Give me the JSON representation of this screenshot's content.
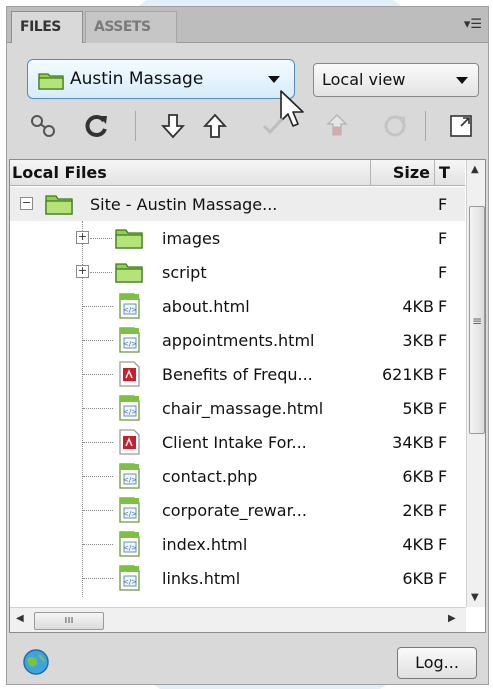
{
  "tabs": [
    {
      "label": "FILES",
      "active": true
    },
    {
      "label": "ASSETS",
      "active": false
    }
  ],
  "panel_menu_icon": "panel-options-icon",
  "site_select": {
    "value": "Austin Massage"
  },
  "view_select": {
    "value": "Local view"
  },
  "toolbar": {
    "icons": [
      "connect-icon",
      "refresh-icon",
      "get-files-icon",
      "put-files-icon",
      "check-out-icon",
      "check-in-icon",
      "synchronize-icon",
      "expand-panel-icon"
    ]
  },
  "columns": {
    "local_files": "Local Files",
    "size": "Size",
    "type": "T"
  },
  "root": {
    "name": "Site - Austin Massage...",
    "type": "F"
  },
  "files": [
    {
      "name": "images",
      "size": "",
      "type": "F",
      "kind": "folder"
    },
    {
      "name": "script",
      "size": "",
      "type": "F",
      "kind": "folder"
    },
    {
      "name": "about.html",
      "size": "4KB",
      "type": "F",
      "kind": "html"
    },
    {
      "name": "appointments.html",
      "size": "3KB",
      "type": "F",
      "kind": "html"
    },
    {
      "name": "Benefits of Frequ...",
      "size": "621KB",
      "type": "F",
      "kind": "pdf"
    },
    {
      "name": "chair_massage.html",
      "size": "5KB",
      "type": "F",
      "kind": "html"
    },
    {
      "name": "Client Intake For...",
      "size": "34KB",
      "type": "F",
      "kind": "pdf"
    },
    {
      "name": "contact.php",
      "size": "6KB",
      "type": "F",
      "kind": "html"
    },
    {
      "name": "corporate_rewar...",
      "size": "2KB",
      "type": "F",
      "kind": "html"
    },
    {
      "name": "index.html",
      "size": "4KB",
      "type": "F",
      "kind": "html"
    },
    {
      "name": "links.html",
      "size": "6KB",
      "type": "F",
      "kind": "html"
    }
  ],
  "footer": {
    "log_label": "Log..."
  },
  "colors": {
    "accent": "#4f8fbf",
    "folder_green": "#7cc242",
    "pdf_red": "#c8202a"
  }
}
